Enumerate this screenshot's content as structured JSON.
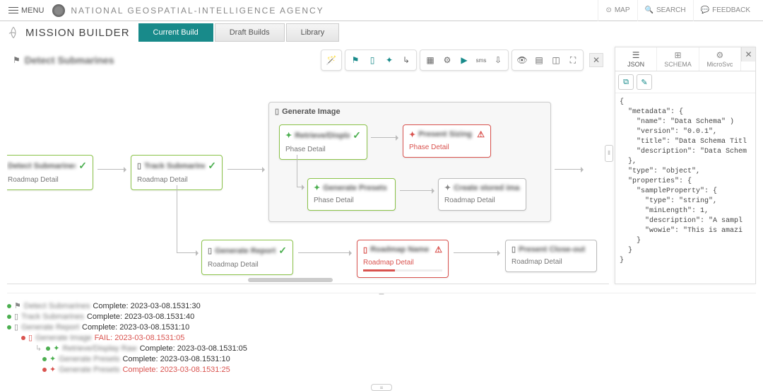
{
  "topbar": {
    "menu": "MENU",
    "agency": "NATIONAL GEOSPATIAL-INTELLIGENCE AGENCY",
    "actions": {
      "map": "MAP",
      "search": "SEARCH",
      "feedback": "FEEDBACK"
    }
  },
  "titlebar": {
    "title": "MISSION BUILDER",
    "tabs": {
      "current": "Current Build",
      "draft": "Draft Builds",
      "library": "Library"
    }
  },
  "canvas": {
    "title": "Detect Submarines",
    "group_title": "Generate Image",
    "detail_roadmap": "Roadmap Detail",
    "detail_phase": "Phase Detail",
    "nodes": {
      "n1": "Detect Submarines",
      "n2": "Track Submarines",
      "n3": "Generate Report",
      "g1": "Retrieve/Display Raw",
      "g2": "Present Sizing UI",
      "g3": "Generate Presets",
      "g4": "Create stored images",
      "n4": "Roadmap Name",
      "n5": "Present Close-out"
    }
  },
  "sidepanel": {
    "tabs": {
      "json": "JSON",
      "schema": "SCHEMA",
      "micro": "MicroSvc"
    },
    "json_text": "{\n  \"metadata\": {\n    \"name\": \"Data Schema\" )\n    \"version\": \"0.0.1\",\n    \"title\": \"Data Schema Titl\n    \"description\": \"Data Schem\n  },\n  \"type\": \"object\",\n  \"properties\": {\n    \"sampleProperty\": {\n      \"type\": \"string\",\n      \"minLength\": 1,\n      \"description\": \"A sampl\n      \"wowie\": \"This is amazi\n    }\n  }\n}"
  },
  "log": {
    "lines": [
      {
        "indent": 0,
        "color": "green",
        "icon": "flag",
        "name": "Detect Submarines",
        "status": "Complete: 2023-03-08.1531:30",
        "err": false
      },
      {
        "indent": 0,
        "color": "green",
        "icon": "map",
        "name": "Track Submarines",
        "status": "Complete: 2023-03-08.1531:40",
        "err": false
      },
      {
        "indent": 0,
        "color": "green",
        "icon": "map",
        "name": "Generate Report",
        "status": "Complete: 2023-03-08.1531:10",
        "err": false
      },
      {
        "indent": 1,
        "color": "red",
        "icon": "map",
        "name": "Generate Image",
        "status": "FAIL: 2023-03-08.1531:05",
        "err": true
      },
      {
        "indent": 2,
        "color": "green",
        "icon": "puzzle",
        "name": "Retrieve/Display Raw",
        "status": "Complete: 2023-03-08.1531:05",
        "err": false,
        "hook": true
      },
      {
        "indent": 3,
        "color": "green",
        "icon": "puzzle",
        "name": "Generate Presets",
        "status": "Complete: 2023-03-08.1531:10",
        "err": false
      },
      {
        "indent": 3,
        "color": "red",
        "icon": "puzzle",
        "name": "Generate Presets",
        "status": "Complete: 2023-03-08.1531:25",
        "err": true
      }
    ]
  }
}
